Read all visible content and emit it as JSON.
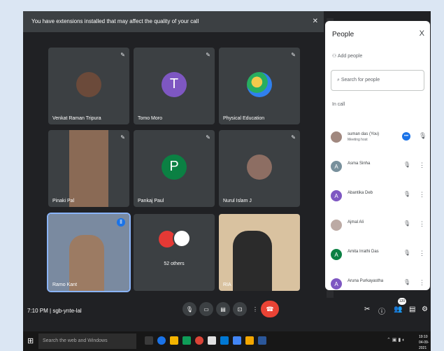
{
  "notice": {
    "text": "You have extensions installed that may affect the quality of your call"
  },
  "tiles": [
    {
      "name": "Venkat Raman Tripura"
    },
    {
      "name": "Tomo Moro",
      "initial": "T"
    },
    {
      "name": "Physical Education"
    },
    {
      "name": "Pinaki Pal"
    },
    {
      "name": "Pankaj Paul",
      "initial": "P"
    },
    {
      "name": "Nurul Islam J"
    },
    {
      "name": "Ramo Kant"
    },
    {
      "name": "52 others"
    },
    {
      "name": "RIA"
    }
  ],
  "panel": {
    "title": "People",
    "close": "X",
    "add_people": "Add people",
    "search_placeholder": "Search for people",
    "in_call": "In call",
    "people": [
      {
        "initial": "",
        "name": "suman das (You)",
        "sub": "Meeting host"
      },
      {
        "initial": "A",
        "name": "Asma Sinha"
      },
      {
        "initial": "A",
        "name": "Abantika Deb"
      },
      {
        "initial": "",
        "name": "Ajmal Ali"
      },
      {
        "initial": "A",
        "name": "Amita Irrathi Das"
      },
      {
        "initial": "A",
        "name": "Aruna Purkayastha"
      }
    ]
  },
  "bottom": {
    "time": "7:10 PM",
    "code": "sgb-ynte-lal",
    "badge": "120"
  },
  "taskbar": {
    "search": "Search the web and Windows",
    "time": "19:10",
    "date": "04-09-2021"
  },
  "colors": {
    "meet_bg": "#202124",
    "tile_bg": "#3c4043",
    "end_call": "#ea4335",
    "highlight": "#8ab4f8"
  }
}
